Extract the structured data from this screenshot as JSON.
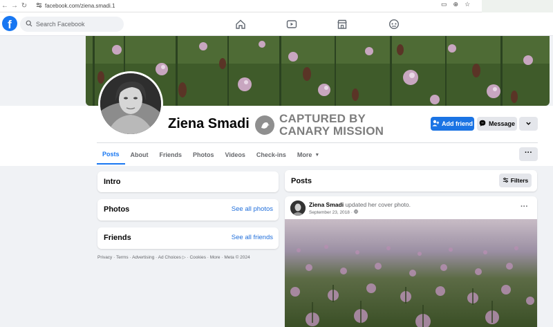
{
  "browser": {
    "url": "facebook.com/ziena.smadi.1"
  },
  "search": {
    "placeholder": "Search Facebook"
  },
  "profile": {
    "name": "Ziena Smadi",
    "stamp_line1": "CAPTURED BY",
    "stamp_line2": "CANARY MISSION"
  },
  "actions": {
    "add_friend": "Add friend",
    "message": "Message"
  },
  "tabs": [
    "Posts",
    "About",
    "Friends",
    "Photos",
    "Videos",
    "Check-ins",
    "More"
  ],
  "left": {
    "intro_title": "Intro",
    "photos_title": "Photos",
    "photos_link": "See all photos",
    "friends_title": "Friends",
    "friends_link": "See all friends",
    "footer": "Privacy · Terms · Advertising · Ad Choices ▷ · Cookies · More · Meta © 2024"
  },
  "posts": {
    "title": "Posts",
    "filters": "Filters",
    "author": "Ziena Smadi",
    "action": "updated her cover photo.",
    "date": "September 23, 2018 · "
  },
  "colors": {
    "brand": "#1877f2",
    "add_friend": "#1b74e4",
    "link": "#216fdb"
  }
}
